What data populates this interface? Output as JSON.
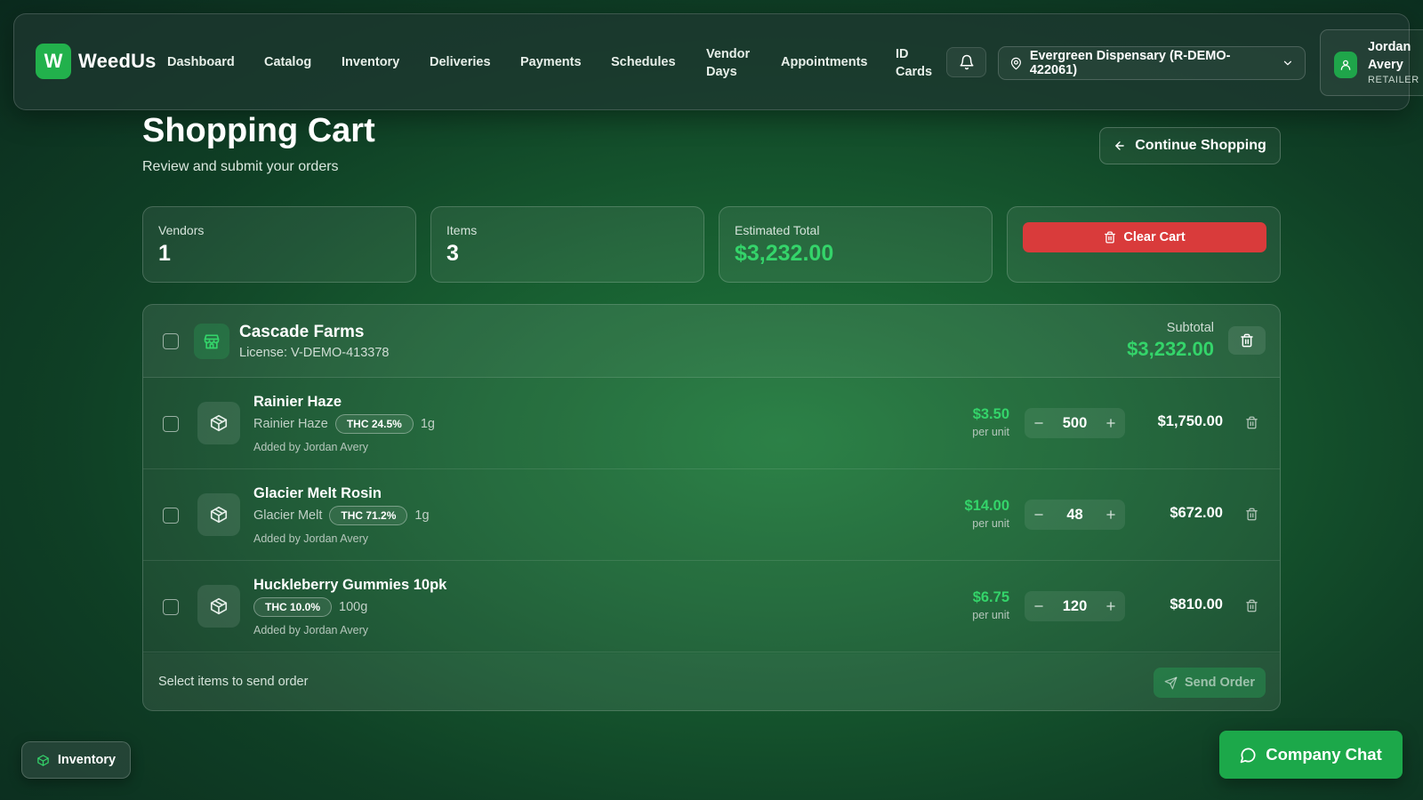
{
  "brand": {
    "logo_letter": "W",
    "name": "WeedUs"
  },
  "nav": {
    "items": [
      "Dashboard",
      "Catalog",
      "Inventory",
      "Deliveries",
      "Payments",
      "Schedules",
      "Vendor Days",
      "Appointments",
      "ID Cards"
    ],
    "location": "Evergreen Dispensary (R-DEMO-422061)",
    "user_name": "Jordan Avery",
    "user_role": "RETAILER"
  },
  "page": {
    "title": "Shopping Cart",
    "subtitle": "Review and submit your orders",
    "continue_label": "Continue Shopping"
  },
  "stats": {
    "vendors_label": "Vendors",
    "vendors_value": "1",
    "items_label": "Items",
    "items_value": "3",
    "total_label": "Estimated Total",
    "total_value": "$3,232.00",
    "clear_label": "Clear Cart"
  },
  "vendor": {
    "name": "Cascade Farms",
    "license": "License: V-DEMO-413378",
    "subtotal_label": "Subtotal",
    "subtotal_value": "$3,232.00"
  },
  "items": [
    {
      "name": "Rainier Haze",
      "strain": "Rainier Haze",
      "thc": "THC 24.5%",
      "size": "1g",
      "added_by": "Added by Jordan Avery",
      "price": "$3.50",
      "per_unit": "per unit",
      "qty": "500",
      "line_total": "$1,750.00"
    },
    {
      "name": "Glacier Melt Rosin",
      "strain": "Glacier Melt",
      "thc": "THC 71.2%",
      "size": "1g",
      "added_by": "Added by Jordan Avery",
      "price": "$14.00",
      "per_unit": "per unit",
      "qty": "48",
      "line_total": "$672.00"
    },
    {
      "name": "Huckleberry Gummies 10pk",
      "strain": "",
      "thc": "THC 10.0%",
      "size": "100g",
      "added_by": "Added by Jordan Avery",
      "price": "$6.75",
      "per_unit": "per unit",
      "qty": "120",
      "line_total": "$810.00"
    }
  ],
  "footer": {
    "hint": "Select items to send order",
    "send_label": "Send Order"
  },
  "floating": {
    "inventory_label": "Inventory",
    "chat_label": "Company Chat"
  },
  "colors": {
    "accent": "#22b14c",
    "price": "#34d46a",
    "danger": "#d93b3b"
  }
}
